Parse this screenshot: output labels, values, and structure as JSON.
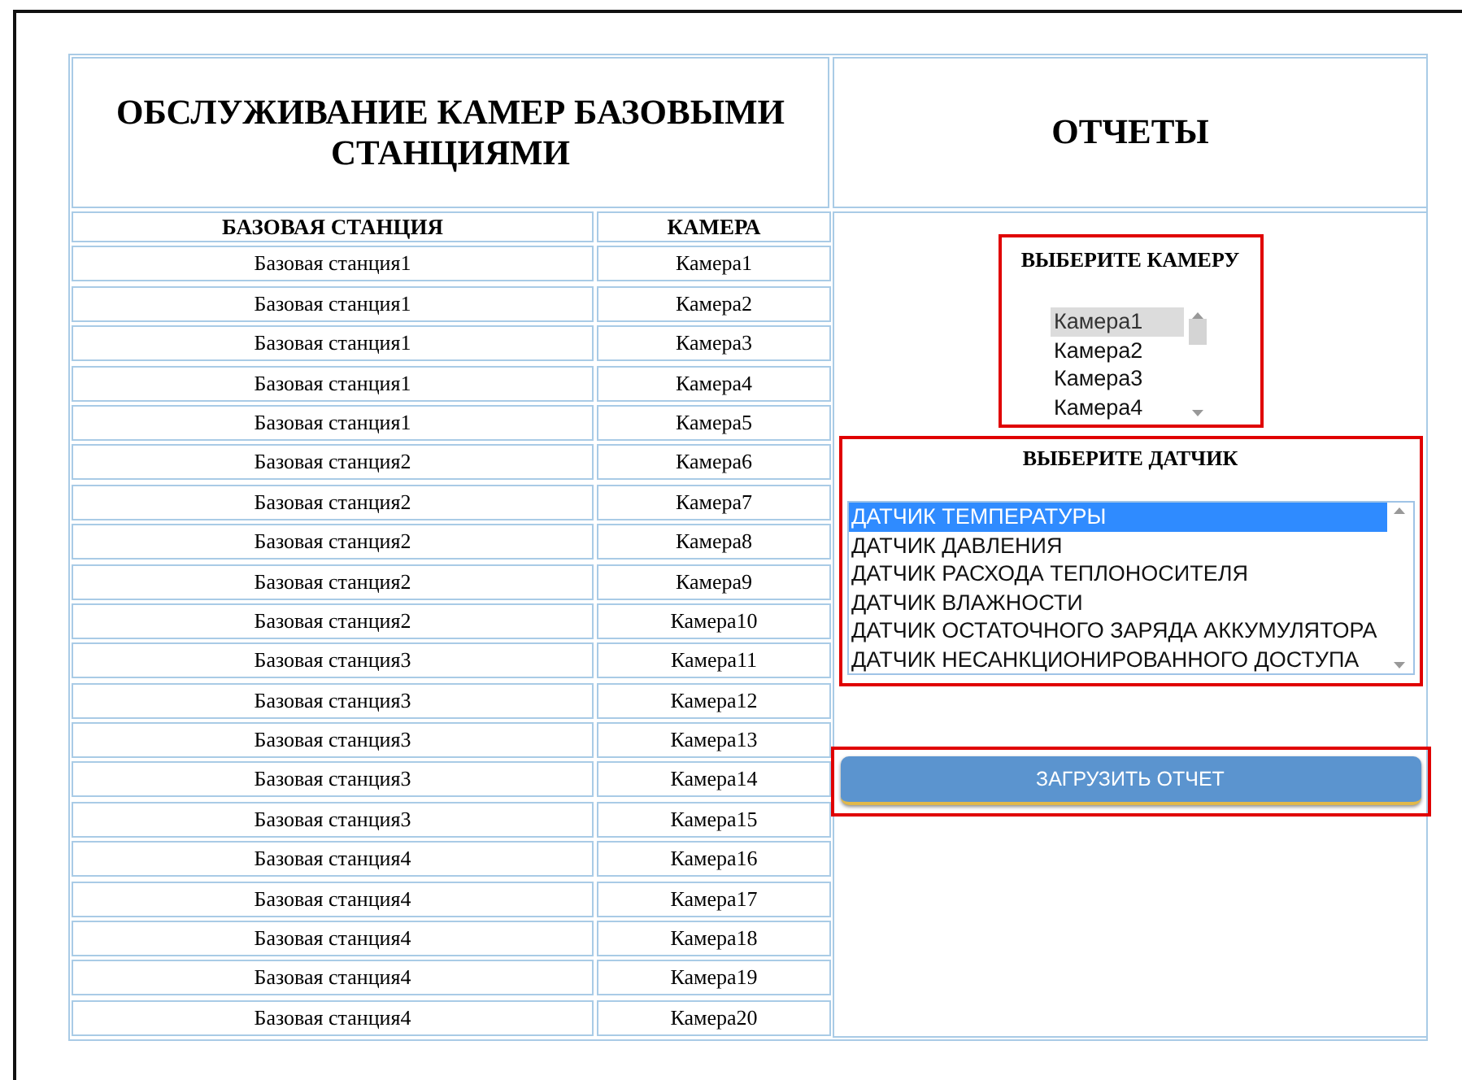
{
  "maintenance": {
    "title": "ОБСЛУЖИВАНИЕ КАМЕР БАЗОВЫМИ СТАНЦИЯМИ",
    "columns": [
      "БАЗОВАЯ СТАНЦИЯ",
      "КАМЕРА"
    ],
    "rows": [
      [
        "Базовая станция1",
        "Камера1"
      ],
      [
        "Базовая станция1",
        "Камера2"
      ],
      [
        "Базовая станция1",
        "Камера3"
      ],
      [
        "Базовая станция1",
        "Камера4"
      ],
      [
        "Базовая станция1",
        "Камера5"
      ],
      [
        "Базовая станция2",
        "Камера6"
      ],
      [
        "Базовая станция2",
        "Камера7"
      ],
      [
        "Базовая станция2",
        "Камера8"
      ],
      [
        "Базовая станция2",
        "Камера9"
      ],
      [
        "Базовая станция2",
        "Камера10"
      ],
      [
        "Базовая станция3",
        "Камера11"
      ],
      [
        "Базовая станция3",
        "Камера12"
      ],
      [
        "Базовая станция3",
        "Камера13"
      ],
      [
        "Базовая станция3",
        "Камера14"
      ],
      [
        "Базовая станция3",
        "Камера15"
      ],
      [
        "Базовая станция4",
        "Камера16"
      ],
      [
        "Базовая станция4",
        "Камера17"
      ],
      [
        "Базовая станция4",
        "Камера18"
      ],
      [
        "Базовая станция4",
        "Камера19"
      ],
      [
        "Базовая станция4",
        "Камера20"
      ]
    ]
  },
  "reports": {
    "title": "ОТЧЕТЫ",
    "camera_select": {
      "label": "ВЫБЕРИТЕ КАМЕРУ",
      "focused": false,
      "options": [
        {
          "label": "Камера1",
          "selected": true
        },
        {
          "label": "Камера2",
          "selected": false
        },
        {
          "label": "Камера3",
          "selected": false
        },
        {
          "label": "Камера4",
          "selected": false
        }
      ]
    },
    "sensor_select": {
      "label": "ВЫБЕРИТЕ ДАТЧИК",
      "focused": true,
      "options": [
        {
          "label": "ДАТЧИК ТЕМПЕРАТУРЫ",
          "selected": true
        },
        {
          "label": "ДАТЧИК ДАВЛЕНИЯ",
          "selected": false
        },
        {
          "label": "ДАТЧИК РАСХОДА ТЕПЛОНОСИТЕЛЯ",
          "selected": false
        },
        {
          "label": "ДАТЧИК ВЛАЖНОСТИ",
          "selected": false
        },
        {
          "label": "ДАТЧИК ОСТАТОЧНОГО ЗАРЯДА АККУМУЛЯТОРА",
          "selected": false
        },
        {
          "label": "ДАТЧИК НЕСАНКЦИОНИРОВАННОГО ДОСТУПА",
          "selected": false
        }
      ]
    },
    "button": "ЗАГРУЗИТЬ ОТЧЕТ"
  }
}
